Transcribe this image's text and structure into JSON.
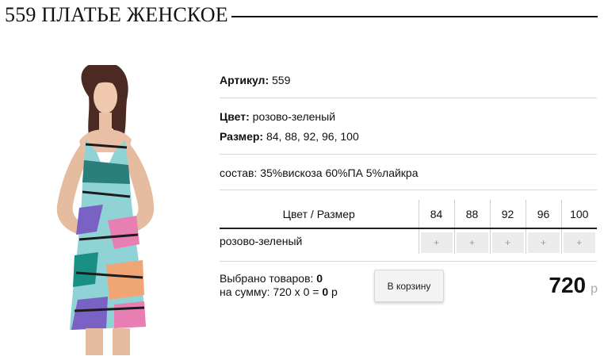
{
  "product": {
    "title": "559 ПЛАТЬЕ ЖЕНСКОЕ",
    "article_label": "Артикул:",
    "article_value": "559",
    "color_label": "Цвет:",
    "color_value": "розово-зеленый",
    "size_label": "Размер:",
    "size_value": "84, 88, 92, 96, 100",
    "composition": "состав: 35%вискоза 60%ПА 5%лайкра"
  },
  "grid": {
    "header_label": "Цвет / Размер",
    "sizes": [
      "84",
      "88",
      "92",
      "96",
      "100"
    ],
    "rows": [
      {
        "label": "розово-зеленый",
        "cells": [
          "+",
          "+",
          "+",
          "+",
          "+"
        ]
      }
    ]
  },
  "summary": {
    "selected_label": "Выбрано товаров:",
    "selected_count": "0",
    "sum_label": "на сумму: 720 x 0 =",
    "sum_value": "0",
    "sum_currency": "р"
  },
  "cart_button": "В корзину",
  "price": {
    "value": "720",
    "currency": "р"
  },
  "colors": {
    "accent_dark": "#111111",
    "cell_bg": "#ececec",
    "divider": "#d9d9d9"
  }
}
